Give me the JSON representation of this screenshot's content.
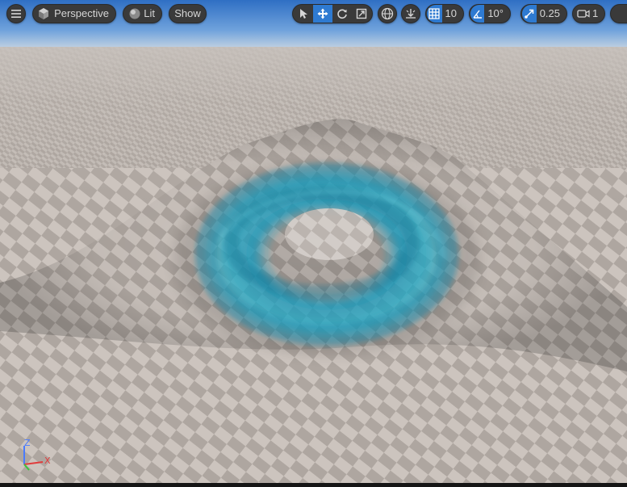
{
  "toolbar": {
    "view_mode": "Perspective",
    "lighting": "Lit",
    "show": "Show",
    "grid_snap": "10",
    "rotate_snap": "10°",
    "scale_snap": "0.25",
    "camera_speed": "1"
  },
  "axis": {
    "z": "Z",
    "x": "X"
  },
  "colors": {
    "accent": "#2e7ad1",
    "toolbar_bg": "#3a3a3a",
    "sky": "#3f7fd0",
    "water": "#1aa6c8"
  },
  "icons": {
    "menu": "hamburger-icon",
    "perspective": "cube-icon",
    "lit": "sphere-icon",
    "select": "cursor-icon",
    "translate": "move-icon",
    "rotate": "rotate-icon",
    "scale": "scale-icon",
    "world": "globe-icon",
    "surface_snap": "surface-snap-icon",
    "grid": "grid-icon",
    "angle": "angle-icon",
    "scale_snap": "scale-arrow-icon",
    "camera": "camera-icon"
  }
}
